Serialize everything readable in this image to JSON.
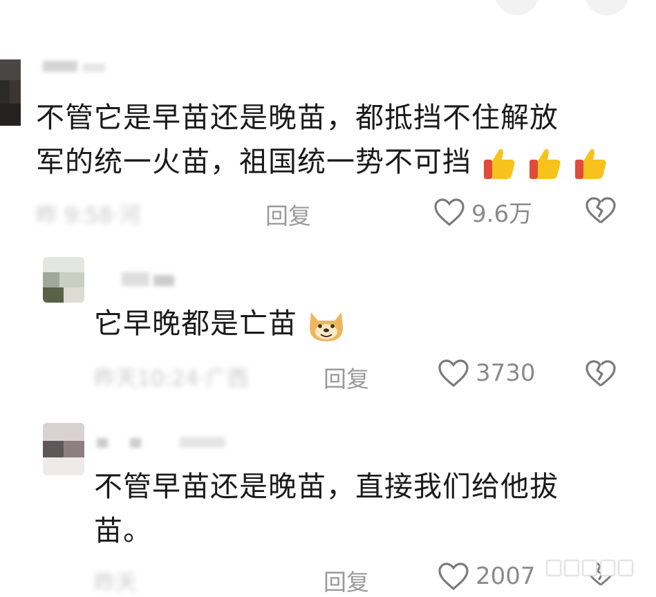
{
  "comments": [
    {
      "id": "c1",
      "text_line1": "不管它是早苗还是晚苗，都抵挡不住解放",
      "text_line2": "军的统一火苗，祖国统一势不可挡",
      "emoji": "thumbs-up-icon x3",
      "meta_obscured": "昨 9:58·河",
      "reply_label": "回复",
      "likes": "9.6万"
    },
    {
      "id": "c2",
      "text_line1": "它早晚都是亡苗",
      "emoji": "doge-face-icon",
      "meta_obscured": "昨天10:24·广西",
      "reply_label": "回复",
      "likes": "3730"
    },
    {
      "id": "c3",
      "text_line1": "不管早苗还是晚苗，直接我们给他拔",
      "text_line2": "苗。",
      "meta_obscured": "昨天",
      "reply_label": "回复",
      "likes": "2007"
    }
  ],
  "colors": {
    "accent_like": "#8a8a8a",
    "thumb_yellow": "#f7c21b",
    "thumb_red": "#e24a3a"
  }
}
